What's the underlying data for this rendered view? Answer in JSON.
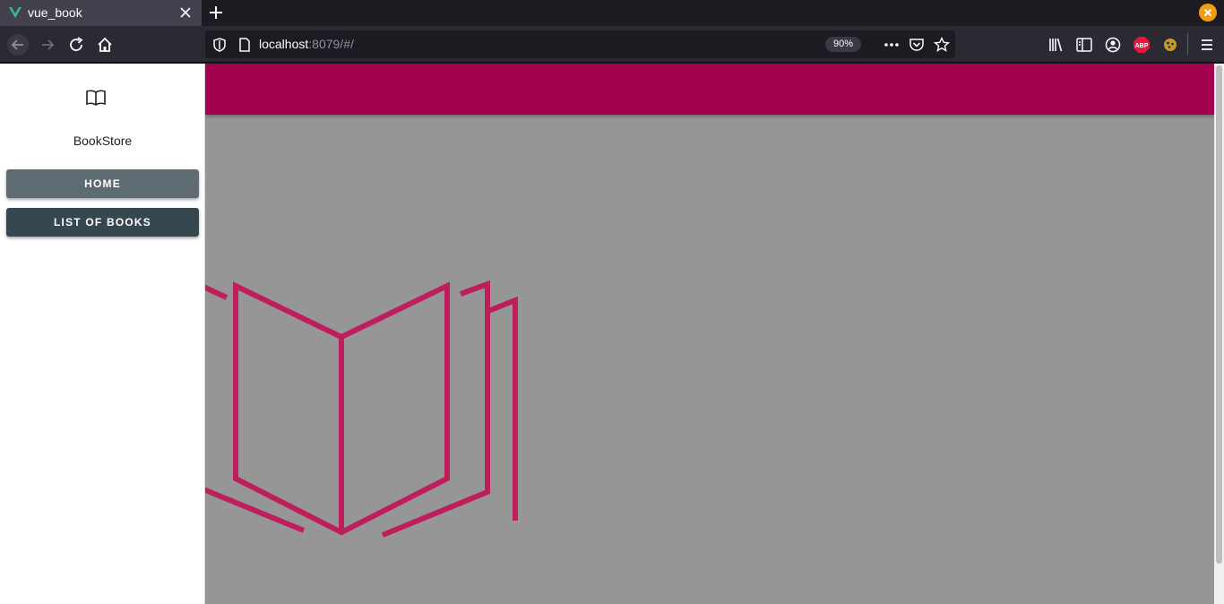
{
  "browser": {
    "tab": {
      "title": "vue_book",
      "favicon": "vue-logo-icon"
    },
    "url": {
      "host": "localhost",
      "rest": ":8079/#/"
    },
    "zoom": "90%",
    "icons": [
      "back-icon",
      "forward-icon",
      "reload-icon",
      "home-icon",
      "shield-icon",
      "page-icon",
      "more-icon",
      "pocket-icon",
      "bookmark-star-icon",
      "library-icon",
      "reader-view-icon",
      "account-icon",
      "adblock-icon",
      "extension-icon",
      "menu-icon"
    ],
    "colors": {
      "vue": "#41b883",
      "close": "#f39c12",
      "adblock": "#e5173f"
    }
  },
  "sidebar": {
    "brand_icon": "open-book-icon",
    "brand_name": "BookStore",
    "buttons": [
      {
        "label": "HOME"
      },
      {
        "label": "LIST OF BOOKS"
      }
    ]
  },
  "main": {
    "appbar_color": "#a3004e",
    "background": "#969696",
    "hero_icon": "open-book-illustration",
    "hero_color": "#c2185b"
  }
}
